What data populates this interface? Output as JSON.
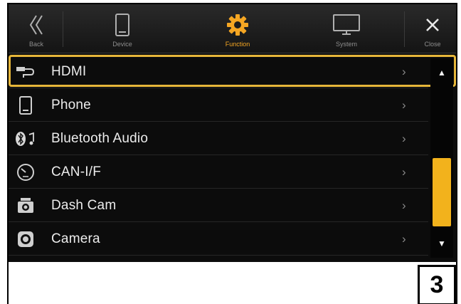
{
  "tabs": [
    {
      "label": "Back",
      "icon": "back-chevron-icon"
    },
    {
      "label": "Device",
      "icon": "device-phone-icon"
    },
    {
      "label": "Function",
      "icon": "gear-icon",
      "active": true
    },
    {
      "label": "System",
      "icon": "monitor-icon"
    },
    {
      "label": "Close",
      "icon": "close-icon"
    }
  ],
  "list": {
    "items": [
      {
        "label": "HDMI",
        "icon": "hdmi-cable-icon",
        "selected": true
      },
      {
        "label": "Phone",
        "icon": "phone-icon"
      },
      {
        "label": "Bluetooth Audio",
        "icon": "bluetooth-audio-icon"
      },
      {
        "label": "CAN-I/F",
        "icon": "gauge-icon"
      },
      {
        "label": "Dash Cam",
        "icon": "dash-cam-icon"
      },
      {
        "label": "Camera",
        "icon": "camera-lens-icon"
      }
    ],
    "chevron": "›"
  },
  "scrollbar": {
    "up": "▲",
    "down": "▼"
  },
  "page_number": "3",
  "colors": {
    "accent": "#f2b21c",
    "highlight_border": "#e6b63a",
    "background": "#0c0c0c"
  }
}
